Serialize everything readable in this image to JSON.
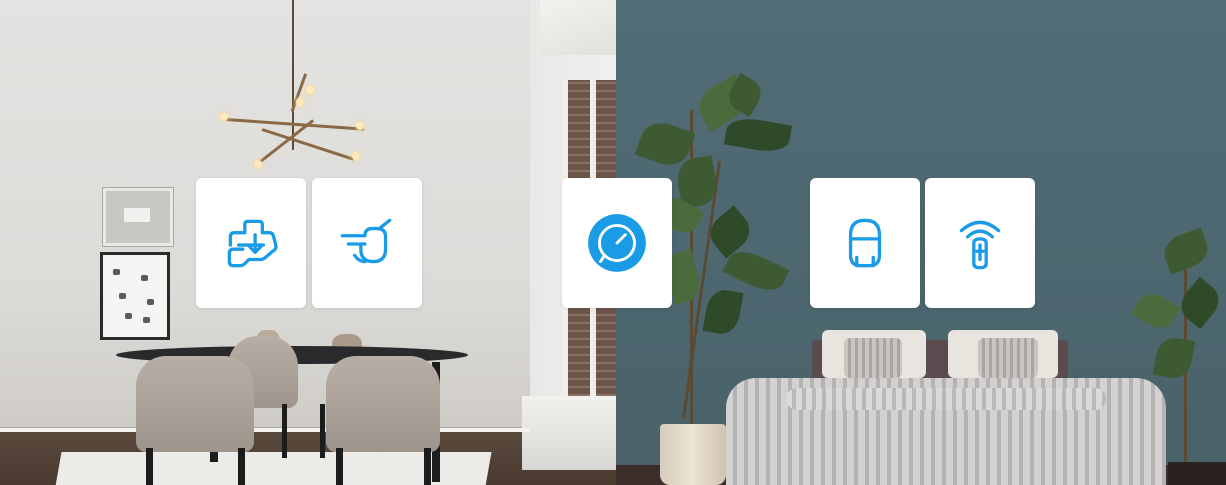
{
  "scene": {
    "left_room": "dining-room",
    "right_room": "bedroom"
  },
  "theme": {
    "accent_color": "#1a9be6",
    "card_background": "#ffffff",
    "left_wall_color": "#e0dfdc",
    "right_wall_color": "#4f6a73"
  },
  "device_cards": [
    {
      "icon": "cleaning-device-icon"
    },
    {
      "icon": "kettle-icon"
    },
    {
      "icon": "round-sensor-icon"
    },
    {
      "icon": "motion-sensor-icon"
    },
    {
      "icon": "wireless-remote-icon"
    }
  ]
}
